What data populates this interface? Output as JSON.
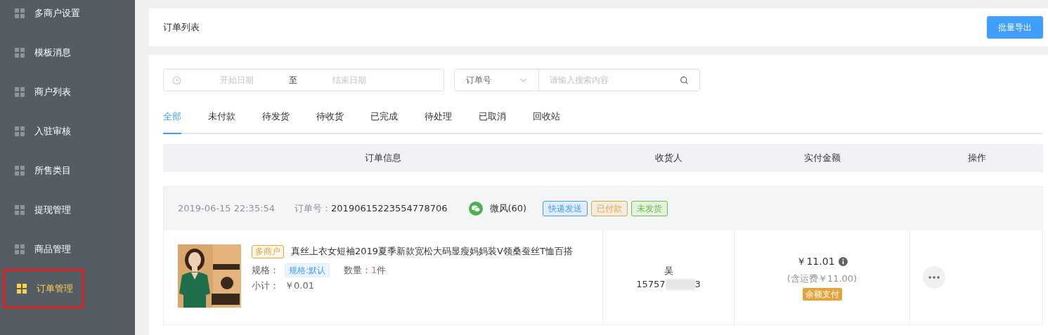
{
  "sidebar": {
    "items": [
      {
        "label": "多商户设置",
        "selected": false
      },
      {
        "label": "模板消息",
        "selected": false
      },
      {
        "label": "商户列表",
        "selected": false
      },
      {
        "label": "入驻审核",
        "selected": false
      },
      {
        "label": "所售类目",
        "selected": false
      },
      {
        "label": "提现管理",
        "selected": false
      },
      {
        "label": "商品管理",
        "selected": false
      },
      {
        "label": "订单管理",
        "selected": true
      }
    ]
  },
  "header": {
    "title": "订单列表",
    "export_button": "批量导出"
  },
  "filters": {
    "start_placeholder": "开始日期",
    "range_separator": "至",
    "end_placeholder": "结束日期",
    "search_type": "订单号",
    "search_placeholder": "请输入搜索内容"
  },
  "tabs": [
    {
      "label": "全部",
      "selected": true
    },
    {
      "label": "未付款",
      "selected": false
    },
    {
      "label": "待发货",
      "selected": false
    },
    {
      "label": "待收货",
      "selected": false
    },
    {
      "label": "已完成",
      "selected": false
    },
    {
      "label": "待处理",
      "selected": false
    },
    {
      "label": "已取消",
      "selected": false
    },
    {
      "label": "回收站",
      "selected": false
    }
  ],
  "table": {
    "columns": [
      "订单信息",
      "收货人",
      "实付金额",
      "操作"
    ]
  },
  "orders": [
    {
      "time": "2019-06-15 22:35:54",
      "order_no_label": "订单号：",
      "order_no": "20190615223554778706",
      "buyer": "微风(60)",
      "tags": [
        {
          "label": "快递发送",
          "color": "#409eff"
        },
        {
          "label": "已付款",
          "color": "#e6a23c"
        },
        {
          "label": "未发货",
          "color": "#67c23a"
        }
      ],
      "product": {
        "badge": "多商户",
        "title": "真丝上衣女短袖2019夏季新款宽松大码显瘦妈妈装V领桑蚕丝T恤百搭",
        "spec_label": "规格：",
        "spec": "规格:默认",
        "qty_label": "数量：",
        "qty": "1",
        "qty_unit": "件",
        "subtotal_label": "小计：",
        "subtotal": "￥0.01"
      },
      "receiver": {
        "name": "吴",
        "phone_start": "15757",
        "phone_end": "3"
      },
      "amount": "￥11.01",
      "shipping": "(含运费￥11.00)",
      "payment": "余额支付"
    }
  ]
}
